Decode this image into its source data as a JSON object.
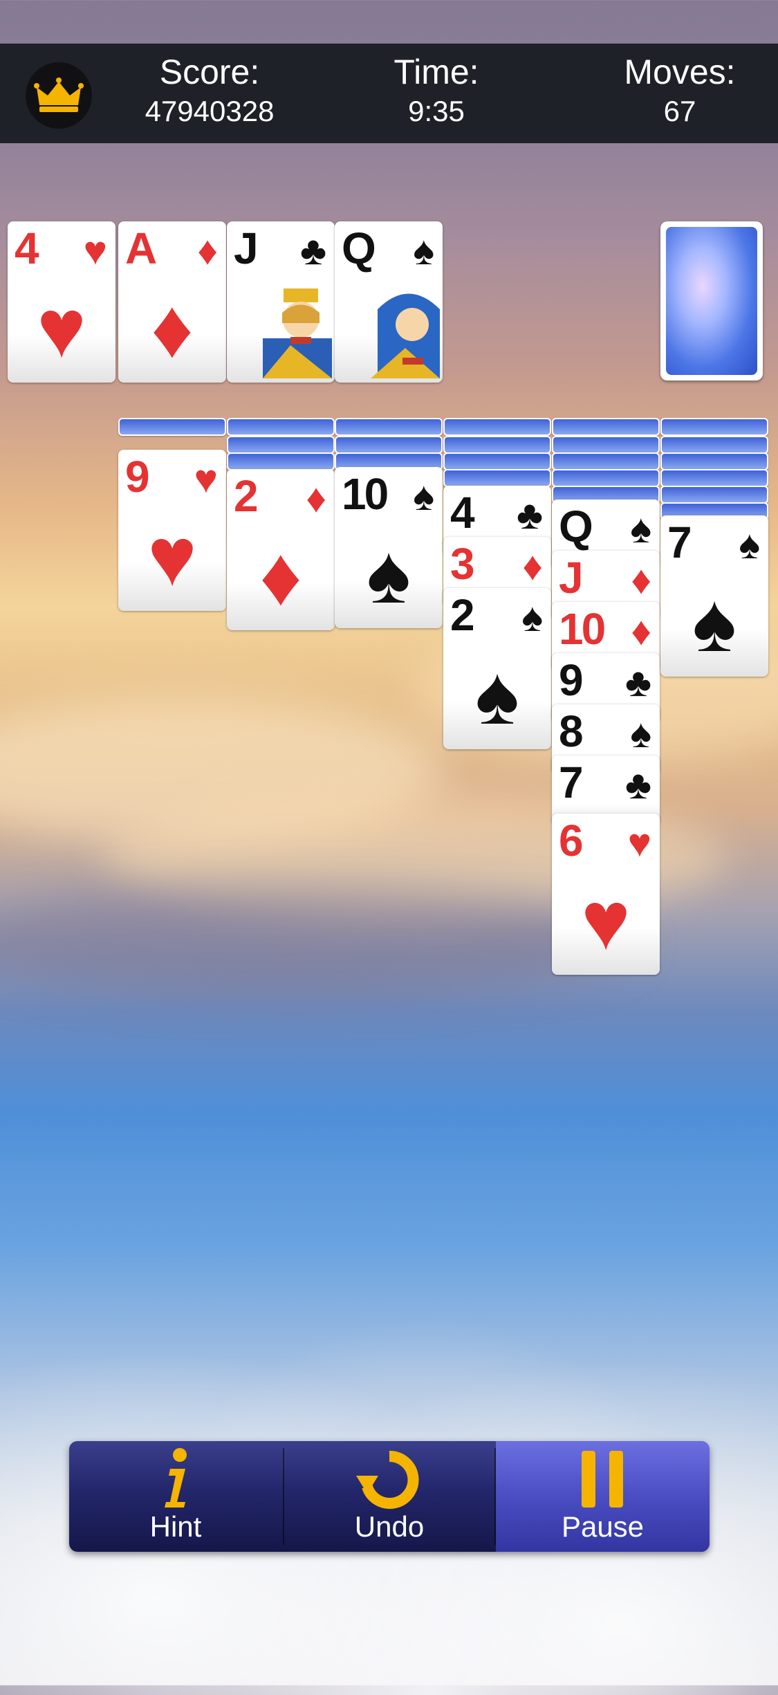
{
  "header": {
    "score_label": "Score:",
    "score_value": "47940328",
    "time_label": "Time:",
    "time_value": "9:35",
    "moves_label": "Moves:",
    "moves_value": "67"
  },
  "foundations": [
    {
      "rank": "4",
      "suit": "♥",
      "color": "red"
    },
    {
      "rank": "A",
      "suit": "♦",
      "color": "red"
    },
    {
      "rank": "J",
      "suit": "♣",
      "color": "black"
    },
    {
      "rank": "Q",
      "suit": "♠",
      "color": "black"
    }
  ],
  "tableau": [
    {
      "face_down": 1,
      "cards": [
        {
          "rank": "9",
          "suit": "♥"
        }
      ]
    },
    {
      "face_down": 3,
      "cards": [
        {
          "rank": "2",
          "suit": "♦"
        }
      ]
    },
    {
      "face_down": 3,
      "cards": [
        {
          "rank": "10",
          "suit": "♠"
        }
      ]
    },
    {
      "face_down": 4,
      "cards": [
        {
          "rank": "4",
          "suit": "♣"
        },
        {
          "rank": "3",
          "suit": "♦"
        },
        {
          "rank": "2",
          "suit": "♠"
        }
      ]
    },
    {
      "face_down": 5,
      "cards": [
        {
          "rank": "Q",
          "suit": "♠"
        },
        {
          "rank": "J",
          "suit": "♦"
        },
        {
          "rank": "10",
          "suit": "♦"
        },
        {
          "rank": "9",
          "suit": "♣"
        },
        {
          "rank": "8",
          "suit": "♠"
        },
        {
          "rank": "7",
          "suit": "♣"
        },
        {
          "rank": "6",
          "suit": "♥"
        }
      ]
    },
    {
      "face_down": 6,
      "cards": [
        {
          "rank": "7",
          "suit": "♠"
        }
      ]
    }
  ],
  "toolbar": {
    "hint_label": "Hint",
    "undo_label": "Undo",
    "pause_label": "Pause"
  },
  "colors": {
    "red_suit": "#e53233",
    "black_suit": "#111111",
    "header_bg": "#1f2128",
    "icon_gold": "#f5b400"
  }
}
